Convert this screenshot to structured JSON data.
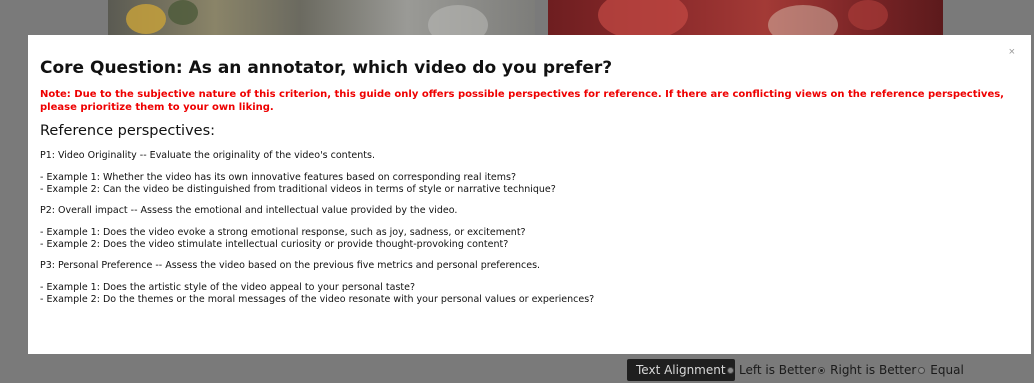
{
  "modal": {
    "close_label": "×",
    "title": "Core Question: As an annotator, which video do you prefer?",
    "note": "Note: Due to the subjective nature of this criterion, this guide only offers possible perspectives for reference. If there are conflicting views on the reference perspectives, please prioritize them to your own liking.",
    "reference_heading": "Reference perspectives:",
    "perspectives": [
      {
        "heading": "P1: Video Originality -- Evaluate the originality of the video's contents.",
        "examples": [
          "- Example 1: Whether the video has its own innovative features based on corresponding real items?",
          "- Example 2: Can the video be distinguished from traditional videos in terms of style or narrative technique?"
        ]
      },
      {
        "heading": "P2: Overall impact -- Assess the emotional and intellectual value provided by the video.",
        "examples": [
          "- Example 1: Does the video evoke a strong emotional response, such as joy, sadness, or excitement?",
          "- Example 2: Does the video stimulate intellectual curiosity or provide thought-provoking content?"
        ]
      },
      {
        "heading": "P3: Personal Preference -- Assess the video based on the previous five metrics and personal preferences.",
        "examples": [
          "- Example 1: Does the artistic style of the video appeal to your personal taste?",
          "- Example 2: Do the themes or the moral messages of the video resonate with your personal values or experiences?"
        ]
      }
    ]
  },
  "bottom_bar": {
    "button_label": "Text Alignment",
    "options": [
      {
        "label": "Left is Better",
        "checked": false
      },
      {
        "label": "Right is Better",
        "checked": true
      },
      {
        "label": "Equal",
        "checked": false
      }
    ]
  },
  "colors": {
    "note": "#ee0000",
    "overlay": "#7a7a7a",
    "button_bg": "#1f1f1f"
  }
}
